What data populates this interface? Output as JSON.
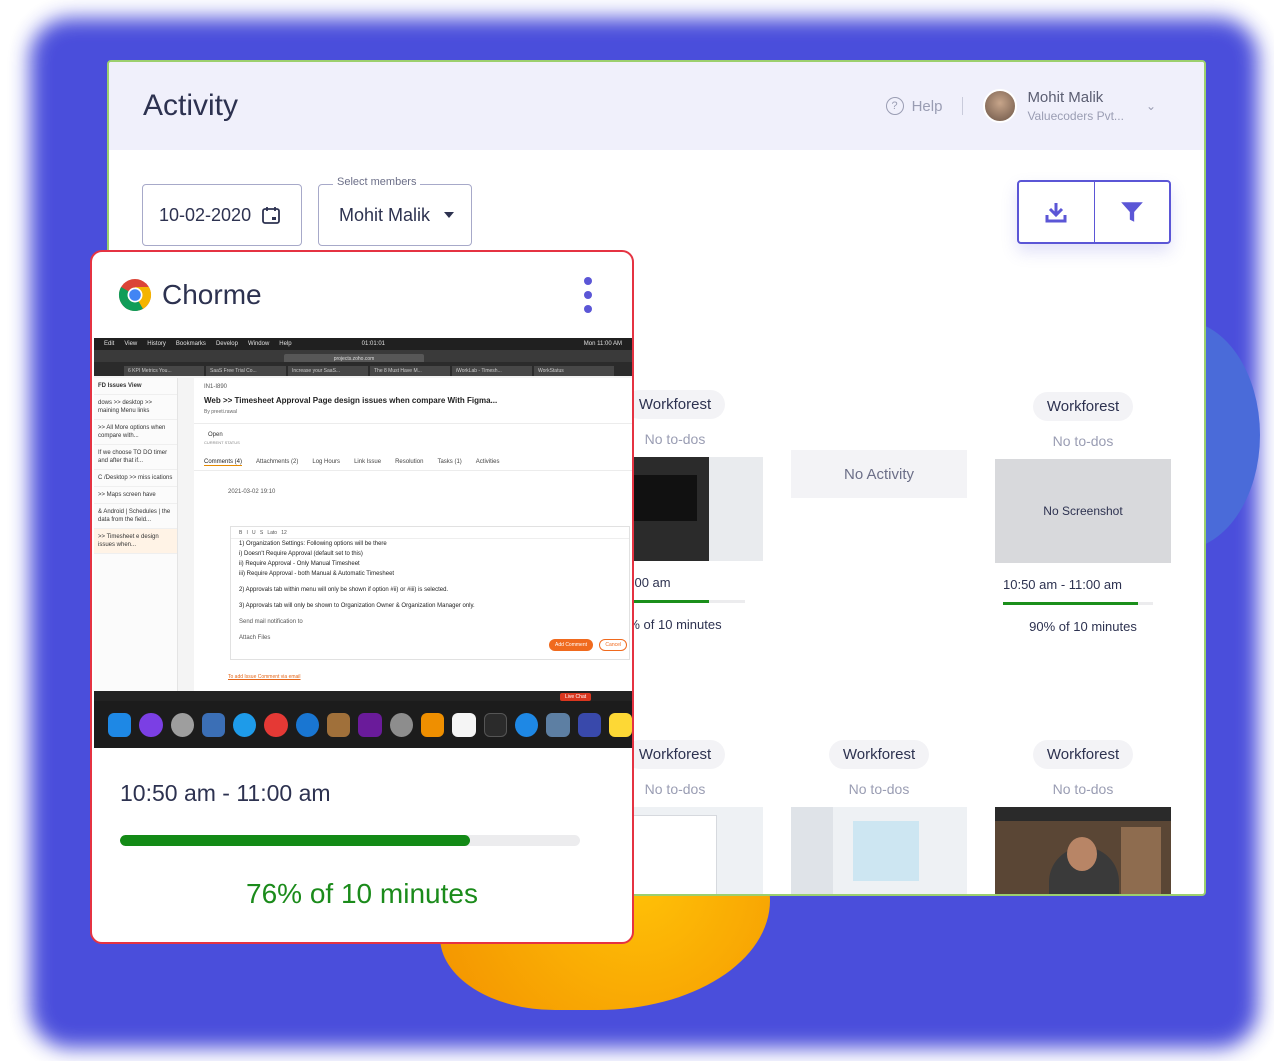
{
  "header": {
    "title": "Activity",
    "help_label": "Help",
    "user_name": "Mohit Malik",
    "user_org": "Valuecoders Pvt..."
  },
  "filters": {
    "date": "10-02-2020",
    "members_label": "Select members",
    "members_value": "Mohit Malik"
  },
  "toolbar": {
    "download_icon": "download-icon",
    "filter_icon": "filter-icon"
  },
  "cards": [
    {
      "project": "Workforest",
      "todos": "No to-dos",
      "time": "m - 11:00 am",
      "pct": "% of 10 minutes",
      "activity": 0.76
    },
    {
      "no_activity": "No Activity"
    },
    {
      "project": "Workforest",
      "todos": "No to-dos",
      "no_screenshot": "No Screenshot",
      "time": "10:50 am - 11:00 am",
      "pct": "90% of 10 minutes",
      "activity": 0.9
    },
    {
      "project": "Workforest",
      "todos": "No to-dos"
    },
    {
      "project": "Workforest",
      "todos": "No to-dos"
    },
    {
      "project": "Workforest",
      "todos": "No to-dos"
    }
  ],
  "popup": {
    "app_name": "Chorme",
    "time": "10:50 am - 11:00 am",
    "activity": 0.76,
    "pct_label": "76% of 10 minutes",
    "screenshot": {
      "menu": [
        "Edit",
        "View",
        "History",
        "Bookmarks",
        "Develop",
        "Window",
        "Help"
      ],
      "clock": "Mon 11:00 AM",
      "timer": "01:01:01",
      "url": "projects.zoho.com",
      "tabs": [
        "6 KPI Metrics You...",
        "SaaS Free Trial Co...",
        "Increase your SaaS...",
        "The 8 Must Have M...",
        "iWorkLab - Timesh...",
        "WorkStatus"
      ],
      "sidebar_title": "FD Issues View",
      "sidebar": [
        "dows >> desktop >> maining Menu links",
        ">> All More options when compare with...",
        "If we choose TO DO timer and after that if...",
        "C /Desktop >> miss ications",
        ">> Maps screen have",
        "& Android | Schedules | the data from the field...",
        ">> Timesheet e design issues when..."
      ],
      "issue_id": "IN1-I890",
      "issue_title": "Web >> Timesheet Approval Page design issues when compare With Figma...",
      "by": "By preeti.rawal",
      "status": "Open",
      "status_caption": "CURRENT STATUS",
      "detail_tabs": [
        "Comments (4)",
        "Attachments (2)",
        "Log Hours",
        "Link Issue",
        "Resolution",
        "Tasks (1)",
        "Activities"
      ],
      "comment_date": "2021-03-02 19:10",
      "editor_lines": [
        "1) Organization Settings: Following options will be there",
        "i) Doesn't Require Approval (default set to this)",
        "ii) Require Approval - Only Manual Timesheet",
        "iii) Require Approval - both Manual & Automatic Timesheet",
        "2) Approvals tab within menu will only be shown if option #ii) or #iii) is selected.",
        "3) Approvals tab will only be shown to Organization Owner & Organization Manager only."
      ],
      "notify": "Send mail notification to",
      "attach": "Attach Files",
      "add_comment": "Add Comment",
      "cancel": "Cancel",
      "add_issue": "To add Issue Comment via email",
      "live_chat": "Live Chat"
    }
  },
  "colors": {
    "accent": "#5b56d6",
    "progress": "#138a16",
    "popup_border": "#e53342"
  }
}
